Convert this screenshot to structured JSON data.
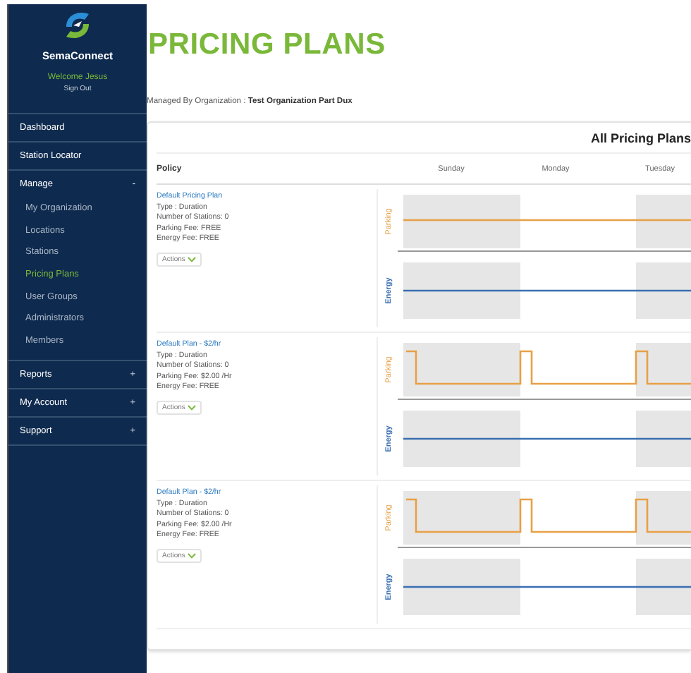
{
  "sidebar": {
    "brand": "SemaConnect",
    "welcome": "Welcome Jesus",
    "sign_out": "Sign Out",
    "items": [
      {
        "label": "Dashboard",
        "selected": false
      },
      {
        "label": "Station Locator",
        "selected": false
      },
      {
        "label": "Manage",
        "toggle": "-",
        "expanded": true,
        "children": [
          {
            "label": "My Organization",
            "selected": false
          },
          {
            "label": "Locations",
            "selected": false
          },
          {
            "label": "Stations",
            "selected": false
          },
          {
            "label": "Pricing Plans",
            "selected": true
          },
          {
            "label": "User Groups",
            "selected": false
          },
          {
            "label": "Administrators",
            "selected": false
          },
          {
            "label": "Members",
            "selected": false
          }
        ]
      },
      {
        "label": "Reports",
        "toggle": "+",
        "expanded": false
      },
      {
        "label": "My Account",
        "toggle": "+",
        "expanded": false
      },
      {
        "label": "Support",
        "toggle": "+",
        "expanded": false
      }
    ]
  },
  "page": {
    "title": "PRICING PLANS",
    "managed_label": "Managed By Organization :",
    "organization": "Test Organization Part Dux"
  },
  "table": {
    "title": "All Pricing Plans",
    "policy_header": "Policy",
    "days": [
      "Sunday",
      "Monday",
      "Tuesday"
    ],
    "plans": [
      {
        "name": "Default Pricing Plan",
        "type": "Type : Duration",
        "stations": "Number of Stations: 0",
        "parking_fee": "Parking Fee: FREE",
        "energy_fee": "Energy Fee: FREE",
        "actions": "Actions",
        "parking_label": "Parking",
        "energy_label": "Energy",
        "kind": "flat"
      },
      {
        "name": "Default Plan - $2/hr",
        "type": "Type : Duration",
        "stations": "Number of Stations: 0",
        "parking_fee": "Parking Fee: $2.00 /Hr",
        "energy_fee": "Energy Fee: FREE",
        "actions": "Actions",
        "parking_label": "Parking",
        "energy_label": "Energy",
        "kind": "pulse"
      },
      {
        "name": "Default Plan - $2/hr",
        "type": "Type : Duration",
        "stations": "Number of Stations: 0",
        "parking_fee": "Parking Fee: $2.00 /Hr",
        "energy_fee": "Energy Fee: FREE",
        "actions": "Actions",
        "parking_label": "Parking",
        "energy_label": "Energy",
        "kind": "pulse"
      }
    ]
  }
}
